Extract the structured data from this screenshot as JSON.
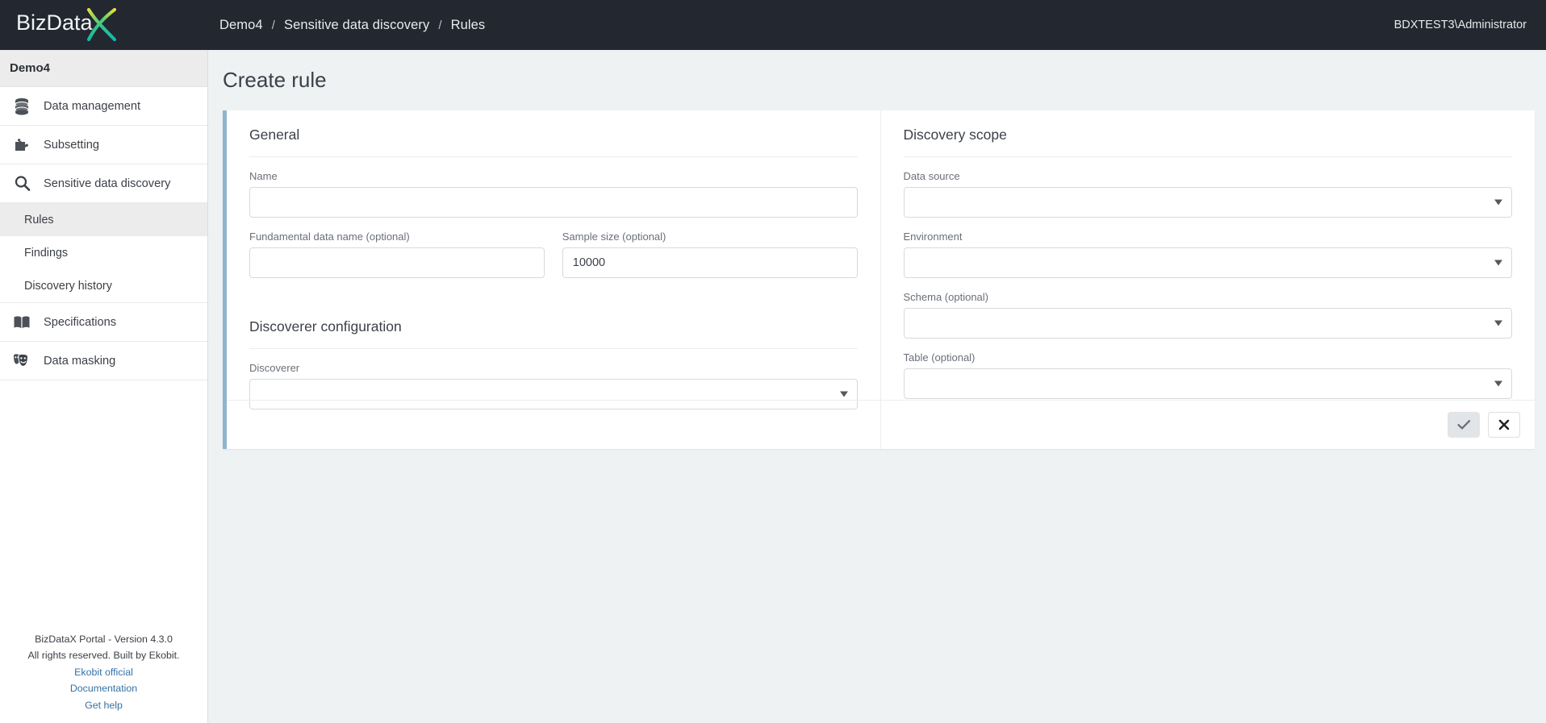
{
  "topbar": {
    "logo_text": "BizData",
    "logo_mark": "X",
    "breadcrumb": [
      "Demo4",
      "Sensitive data discovery",
      "Rules"
    ],
    "separator": "/",
    "user": "BDXTEST3\\Administrator"
  },
  "sidebar": {
    "header": "Demo4",
    "items": [
      {
        "label": "Data management",
        "icon": "database-icon"
      },
      {
        "label": "Subsetting",
        "icon": "puzzle-piece-icon"
      },
      {
        "label": "Sensitive data discovery",
        "icon": "magnifier-icon"
      }
    ],
    "subitems": [
      {
        "label": "Rules",
        "active": true
      },
      {
        "label": "Findings",
        "active": false
      },
      {
        "label": "Discovery history",
        "active": false
      }
    ],
    "items_after": [
      {
        "label": "Specifications",
        "icon": "book-icon"
      },
      {
        "label": "Data masking",
        "icon": "theater-masks-icon"
      }
    ],
    "footer": {
      "version": "BizDataX Portal - Version 4.3.0",
      "rights": "All rights reserved. Built by Ekobit.",
      "links": [
        "Ekobit official",
        "Documentation",
        "Get help"
      ]
    }
  },
  "main": {
    "page_title": "Create rule",
    "general": {
      "section_title": "General",
      "name_label": "Name",
      "name_value": "",
      "fundamental_label": "Fundamental data name (optional)",
      "fundamental_value": "",
      "sample_label": "Sample size (optional)",
      "sample_value": "10000"
    },
    "discoverer": {
      "section_title": "Discoverer configuration",
      "discoverer_label": "Discoverer",
      "discoverer_value": ""
    },
    "scope": {
      "section_title": "Discovery scope",
      "data_source_label": "Data source",
      "data_source_value": "",
      "environment_label": "Environment",
      "environment_value": "",
      "schema_label": "Schema (optional)",
      "schema_value": "",
      "table_label": "Table (optional)",
      "table_value": ""
    },
    "actions": {
      "confirm_icon": "check-icon",
      "cancel_icon": "close-icon"
    }
  },
  "colors": {
    "topbar_bg": "#23272f",
    "card_accent": "#8fb5ce",
    "page_bg": "#eef2f3",
    "link": "#3572a5",
    "sidebar_active": "#ececec"
  }
}
